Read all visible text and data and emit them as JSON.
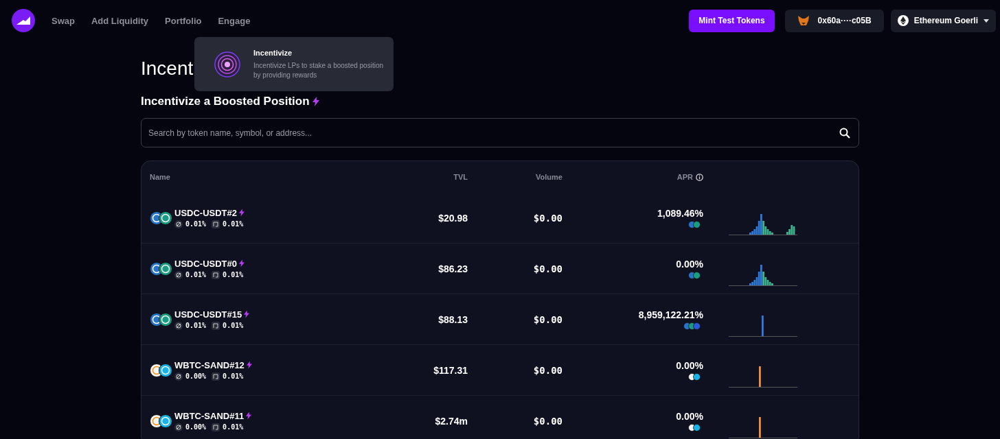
{
  "nav": {
    "items": [
      "Swap",
      "Add Liquidity",
      "Portfolio",
      "Engage"
    ],
    "mint_button": "Mint Test Tokens",
    "wallet": "0x60a····c05B",
    "network": "Ethereum Goerli"
  },
  "engage_menu": {
    "title": "Incentivize",
    "description": "Incentivize LPs to stake a boosted position by providing rewards"
  },
  "page_title": "Incent",
  "section_title": "Incentivize a Boosted Position",
  "search": {
    "placeholder": "Search by token name, symbol, or address..."
  },
  "table": {
    "columns": [
      "Name",
      "TVL",
      "Volume",
      "APR"
    ],
    "rows": [
      {
        "name": "USDC-USDT#2",
        "tokens": [
          {
            "kind": "usdc"
          },
          {
            "kind": "usdt"
          }
        ],
        "swap_fee": "0.01%",
        "range": "0.01%",
        "tvl": "$20.98",
        "volume": "$0.00",
        "apr": "1,089.46%",
        "rewards": [
          {
            "kind": "usdc"
          },
          {
            "kind": "usdt"
          }
        ],
        "chart": {
          "kind": "wide"
        }
      },
      {
        "name": "USDC-USDT#0",
        "tokens": [
          {
            "kind": "usdc"
          },
          {
            "kind": "usdt"
          }
        ],
        "swap_fee": "0.01%",
        "range": "0.01%",
        "tvl": "$86.23",
        "volume": "$0.00",
        "apr": "0.00%",
        "rewards": [
          {
            "kind": "usdc"
          },
          {
            "kind": "usdt"
          }
        ],
        "chart": {
          "kind": "bell"
        }
      },
      {
        "name": "USDC-USDT#15",
        "tokens": [
          {
            "kind": "usdc"
          },
          {
            "kind": "usdt"
          }
        ],
        "swap_fee": "0.01%",
        "range": "0.01%",
        "tvl": "$88.13",
        "volume": "$0.00",
        "apr": "8,959,122.21%",
        "rewards": [
          {
            "kind": "usdc"
          },
          {
            "kind": "usdt"
          },
          {
            "kind": "link"
          }
        ],
        "chart": {
          "kind": "blue-spike"
        }
      },
      {
        "name": "WBTC-SAND#12",
        "tokens": [
          {
            "kind": "wbtc"
          },
          {
            "kind": "sand"
          }
        ],
        "swap_fee": "0.00%",
        "range": "0.01%",
        "tvl": "$117.31",
        "volume": "$0.00",
        "apr": "0.00%",
        "rewards": [
          {
            "kind": "wbtc"
          },
          {
            "kind": "sand"
          }
        ],
        "chart": {
          "kind": "orange-spike"
        }
      },
      {
        "name": "WBTC-SAND#11",
        "tokens": [
          {
            "kind": "wbtc"
          },
          {
            "kind": "sand"
          }
        ],
        "swap_fee": "0.00%",
        "range": "0.01%",
        "tvl": "$2.74m",
        "volume": "$0.00",
        "apr": "0.00%",
        "rewards": [
          {
            "kind": "wbtc"
          },
          {
            "kind": "sand"
          }
        ],
        "chart": {
          "kind": "orange-spike"
        }
      }
    ]
  }
}
